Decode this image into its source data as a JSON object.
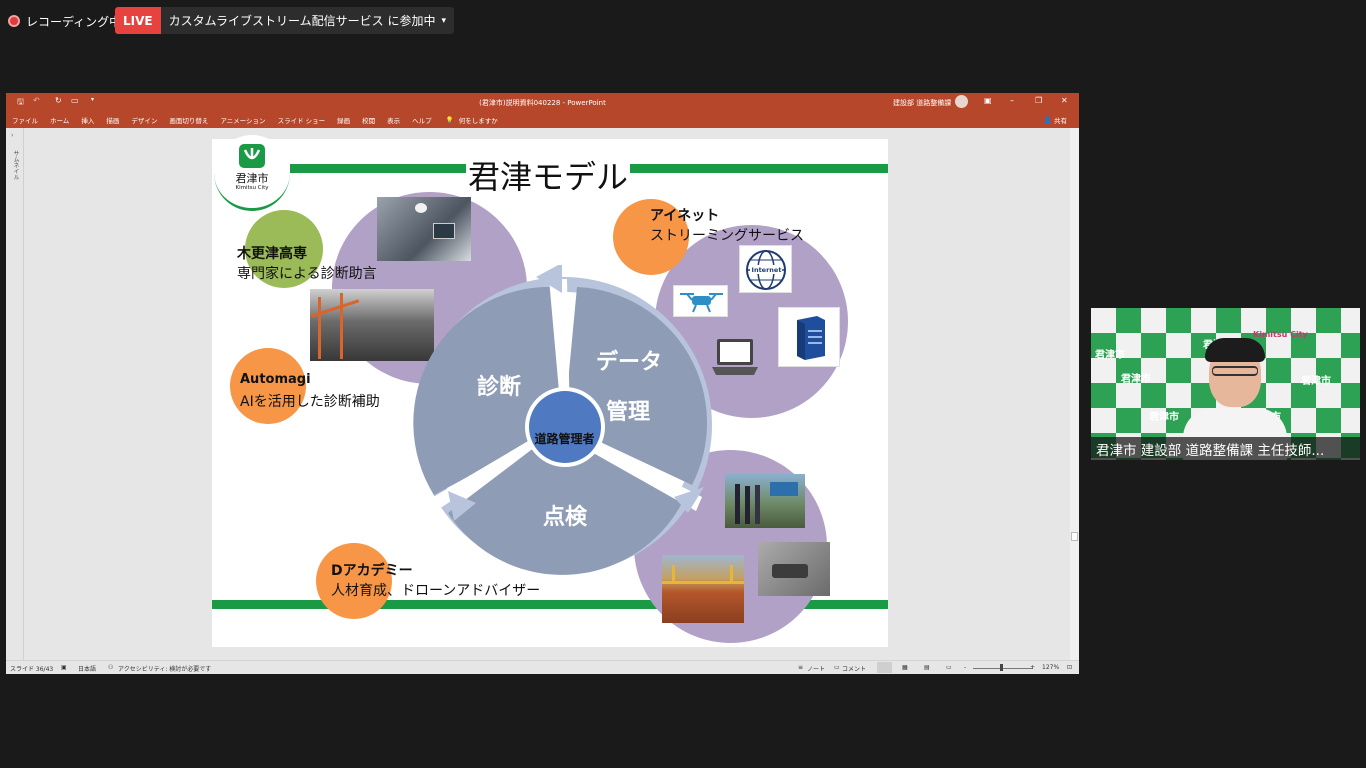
{
  "recording": {
    "label": "レコーディング中"
  },
  "live": {
    "badge": "LIVE",
    "text": "カスタムライブストリーム配信サービス に参加中",
    "caret": "▾"
  },
  "ppt": {
    "title": "(君津市)説明資料040228 - PowerPoint",
    "user": "建設部 道路整備課",
    "menu": [
      "ファイル",
      "ホーム",
      "挿入",
      "描画",
      "デザイン",
      "画面切り替え",
      "アニメーション",
      "スライド ショー",
      "録画",
      "校閲",
      "表示",
      "ヘルプ"
    ],
    "search": "何をしますか",
    "share": "共有",
    "thumb_pane": "サムネイル",
    "status": {
      "slide": "スライド 36/43",
      "lang": "日本語",
      "accessibility": "アクセシビリティ: 検討が必要です",
      "notes": "ノート",
      "comments": "コメント",
      "zoom": "127%",
      "minus": "-",
      "plus": "+"
    }
  },
  "slide": {
    "logo": {
      "kanji": "君津市",
      "roman": "Kimitsu City"
    },
    "title": "君津モデル",
    "kisarazu": {
      "title": "木更津高専",
      "desc": "専門家による診断助言"
    },
    "automagi": {
      "title": "Automagi",
      "desc": "AIを活用した診断補助"
    },
    "inet": {
      "title": "アイネット",
      "desc": "ストリーミングサービス"
    },
    "dacademy": {
      "title": "Dアカデミー",
      "desc": "人材育成、ドローンアドバイザー"
    },
    "cycle": {
      "diag": "診断",
      "data1": "データ",
      "data2": "管理",
      "inspect": "点検",
      "center": "道路管理者"
    },
    "internet_label": "Internet"
  },
  "cam": {
    "label": "君津市 建設部 道路整備課 主任技師...",
    "bg_words": [
      "君津市",
      "君津市",
      "君津市",
      "君津市",
      "君津市",
      "君津市"
    ],
    "brand": "Kimitsu City"
  },
  "colors": {
    "ppt": "#b7472a",
    "live": "#e8423f",
    "green": "#1a9a45",
    "orange": "#f79646",
    "lime": "#9bbb59",
    "cycle": "#8f9cb5",
    "center": "#4f7ac2"
  }
}
